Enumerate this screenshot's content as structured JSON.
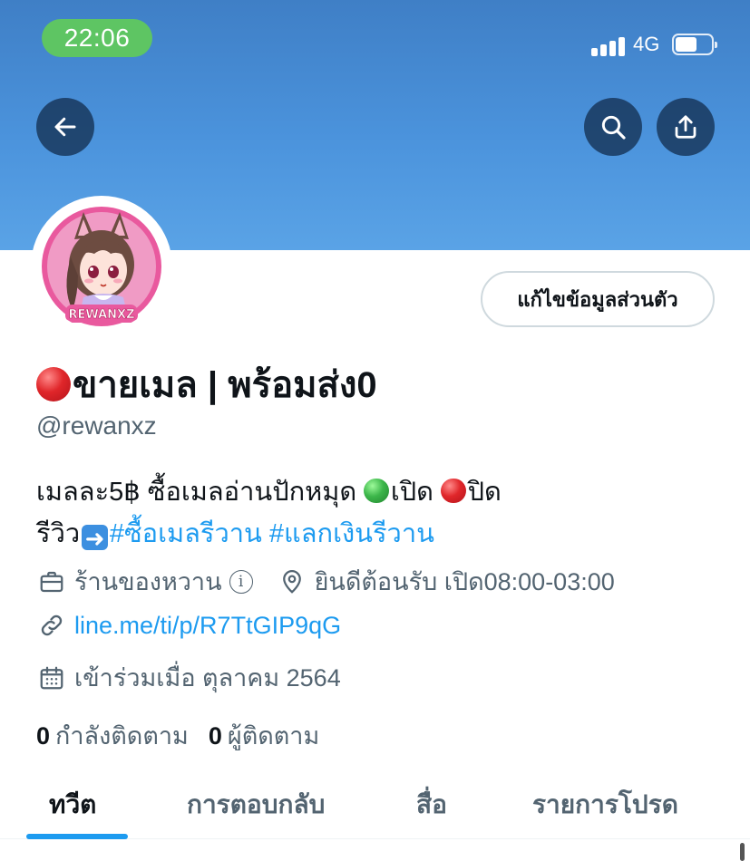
{
  "status_bar": {
    "time": "22:06",
    "network": "4G",
    "signal_bars": 4,
    "battery_level": 0.6
  },
  "profile": {
    "display_name": "ขายเมล | พร้อมส่ง0",
    "handle": "@rewanxz",
    "edit_button_label": "แก้ไขข้อมูลส่วนตัว",
    "avatar_text": "REWANXZ",
    "bio": {
      "line1_text": "เมลละ5฿ ซื้อเมลอ่านปักหมุด ",
      "open_label": "เปิด ",
      "close_label": "ปิด",
      "line2_prefix": "รีวิว",
      "hashtag1": "#ซื้อเมลรีวาน",
      "hashtag2": "#แลกเงินรีวาน"
    },
    "category": "ร้านของหวาน",
    "location": "ยินดีต้อนรับ เปิด08:00-03:00",
    "website": "line.me/ti/p/R7TtGIP9qG",
    "joined": "เข้าร่วมเมื่อ ตุลาคม 2564",
    "following_count": "0",
    "following_label": "กำลังติดตาม",
    "followers_count": "0",
    "followers_label": "ผู้ติดตาม"
  },
  "tabs": [
    {
      "label": "ทวีต",
      "active": true
    },
    {
      "label": "การตอบกลับ",
      "active": false
    },
    {
      "label": "สื่อ",
      "active": false
    },
    {
      "label": "รายการโปรด",
      "active": false
    }
  ],
  "colors": {
    "banner": "#4b93dc",
    "link": "#1d9bf0",
    "secondary_text": "#536471",
    "time_pill": "#5ec563"
  },
  "icons": {
    "back": "arrow-left-icon",
    "search": "search-icon",
    "share": "share-icon",
    "category": "briefcase-icon",
    "location": "location-pin-icon",
    "website": "link-icon",
    "joined": "calendar-icon",
    "info": "info-icon"
  }
}
